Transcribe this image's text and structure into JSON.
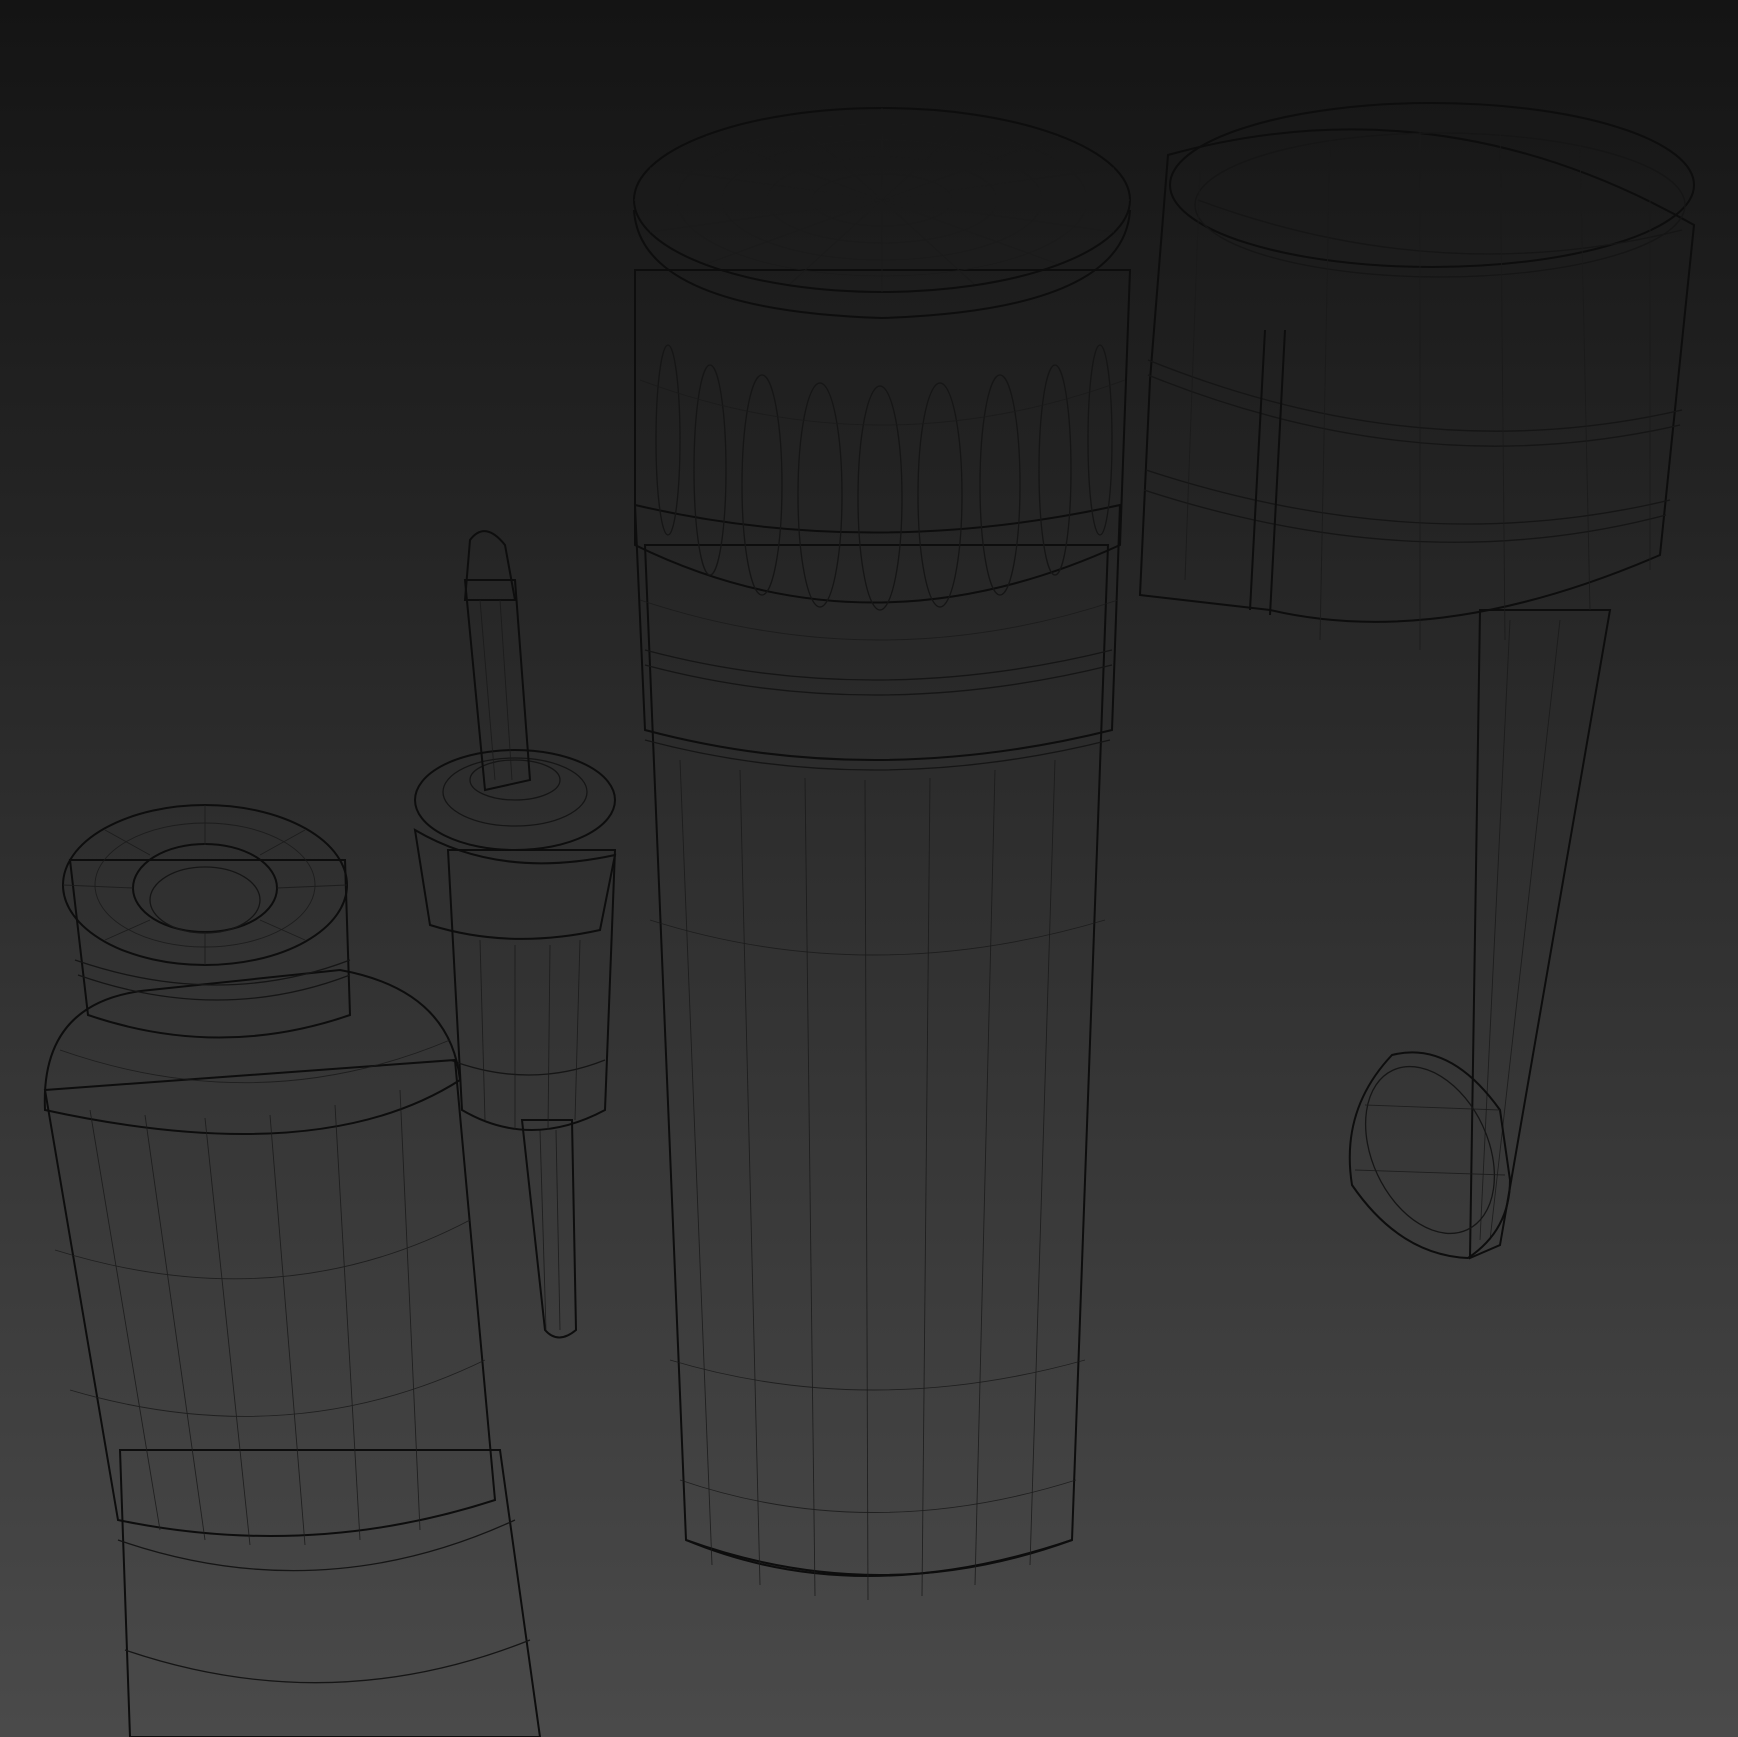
{
  "scene": {
    "background_top": "#141414",
    "background_bottom": "#4a4a4a",
    "surface_light": "#5e5e5e",
    "surface_mid": "#4a4a4a",
    "surface_dark": "#2c2c2c",
    "wire_color": "#151515"
  },
  "objects": [
    {
      "name": "capped-cylinder-canister"
    },
    {
      "name": "open-clip-ring-holder"
    },
    {
      "name": "valve-pin"
    },
    {
      "name": "threaded-bottle-body"
    }
  ]
}
